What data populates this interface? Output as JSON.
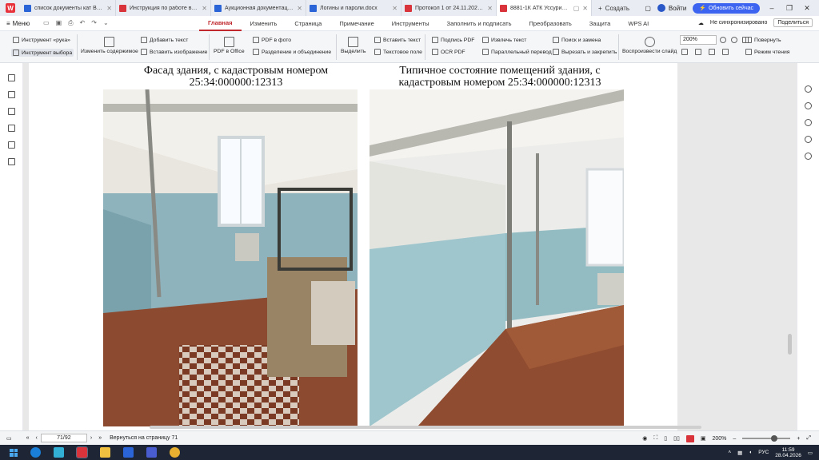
{
  "tabs": [
    {
      "icon": "w",
      "label": "список документы кат В_ка",
      "active": false
    },
    {
      "icon": "p",
      "label": "Инструкция по работе в Камул",
      "active": false
    },
    {
      "icon": "w",
      "label": "Аукционная документация_Апс",
      "active": false
    },
    {
      "icon": "w",
      "label": "Логины и пароли.docx",
      "active": false
    },
    {
      "icon": "p",
      "label": "Протокол 1 от 24.11.2025.pdf",
      "active": false
    },
    {
      "icon": "p",
      "label": "8881-1К АТК Уссурийск, ...",
      "active": true
    }
  ],
  "titlebar": {
    "new_tab": "Создать",
    "login": "Войти",
    "update": "Обновить сейчас"
  },
  "menu": {
    "menu_label": "Меню",
    "ribbon_tabs": [
      "Главная",
      "Изменить",
      "Страница",
      "Примечание",
      "Инструменты",
      "Заполнить и подписать",
      "Преобразовать",
      "Защита",
      "WPS AI"
    ],
    "sync_status": "Не синхронизировано",
    "share": "Поделиться"
  },
  "toolbar": {
    "hand_tool": "Инструмент «рука»",
    "select_tool": "Инструмент выбора",
    "edit_content": "Изменить содержимое",
    "add_text": "Добавить текст",
    "insert_image": "Вставить изображение",
    "pdf_to_office": "PDF в Office",
    "pdf_to_photo": "PDF в фото",
    "split_merge": "Разделение и объединение",
    "highlight": "Выделить",
    "insert_text": "Вставить текст",
    "text_field": "Текстовое поле",
    "sign_pdf": "Подпись PDF",
    "ocr_pdf": "OCR PDF",
    "extract_text": "Извлечь текст",
    "parallel_translate": "Параллельный перевод",
    "find_replace": "Поиск и замена",
    "cut_pin": "Вырезать и закрепить",
    "play_slides": "Воспроизвести слайд",
    "zoom": "200%",
    "rotate": "Повернуть",
    "reading_mode": "Режим чтения"
  },
  "document": {
    "caption_left": "Фасад здания, с кадастровым номером 25:34:000000:12313",
    "caption_right": "Типичное состояние помещений здания, с кадастровым номером 25:34:000000:12313"
  },
  "statusbar": {
    "page": "71/92",
    "back_to_page": "Вернуться на страницу 71",
    "zoom": "200%"
  },
  "taskbar": {
    "lang": "РУС",
    "time": "11:59",
    "date": "28.04.2026"
  }
}
